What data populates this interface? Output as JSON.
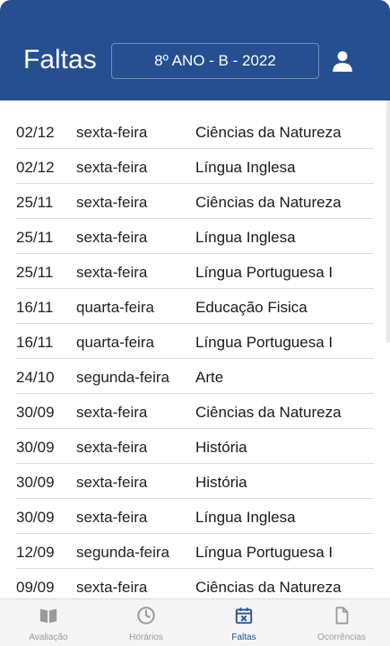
{
  "header": {
    "title": "Faltas",
    "class_select": "8º ANO - B - 2022",
    "profile_icon": "person-icon"
  },
  "absences": [
    {
      "date": "02/12",
      "weekday": "sexta-feira",
      "subject": "Ciências da Natureza"
    },
    {
      "date": "02/12",
      "weekday": "sexta-feira",
      "subject": "Língua Inglesa"
    },
    {
      "date": "25/11",
      "weekday": "sexta-feira",
      "subject": "Ciências da Natureza"
    },
    {
      "date": "25/11",
      "weekday": "sexta-feira",
      "subject": "Língua Inglesa"
    },
    {
      "date": "25/11",
      "weekday": "sexta-feira",
      "subject": "Língua Portuguesa I"
    },
    {
      "date": "16/11",
      "weekday": "quarta-feira",
      "subject": "Educação Fisica"
    },
    {
      "date": "16/11",
      "weekday": "quarta-feira",
      "subject": "Língua Portuguesa I"
    },
    {
      "date": "24/10",
      "weekday": "segunda-feira",
      "subject": "Arte"
    },
    {
      "date": "30/09",
      "weekday": "sexta-feira",
      "subject": "Ciências da Natureza"
    },
    {
      "date": "30/09",
      "weekday": "sexta-feira",
      "subject": "História"
    },
    {
      "date": "30/09",
      "weekday": "sexta-feira",
      "subject": "História"
    },
    {
      "date": "30/09",
      "weekday": "sexta-feira",
      "subject": "Língua Inglesa"
    },
    {
      "date": "12/09",
      "weekday": "segunda-feira",
      "subject": "Língua Portuguesa I"
    },
    {
      "date": "09/09",
      "weekday": "sexta-feira",
      "subject": "Ciências da Natureza"
    }
  ],
  "bottom_nav": {
    "items": [
      {
        "label": "Avaliação",
        "icon": "book-icon",
        "active": false
      },
      {
        "label": "Horários",
        "icon": "clock-icon",
        "active": false
      },
      {
        "label": "Faltas",
        "icon": "calendar-x-icon",
        "active": true
      },
      {
        "label": "Ocorrências",
        "icon": "document-icon",
        "active": false
      }
    ]
  },
  "colors": {
    "primary": "#254f91",
    "inactive": "#9a9a9a"
  }
}
